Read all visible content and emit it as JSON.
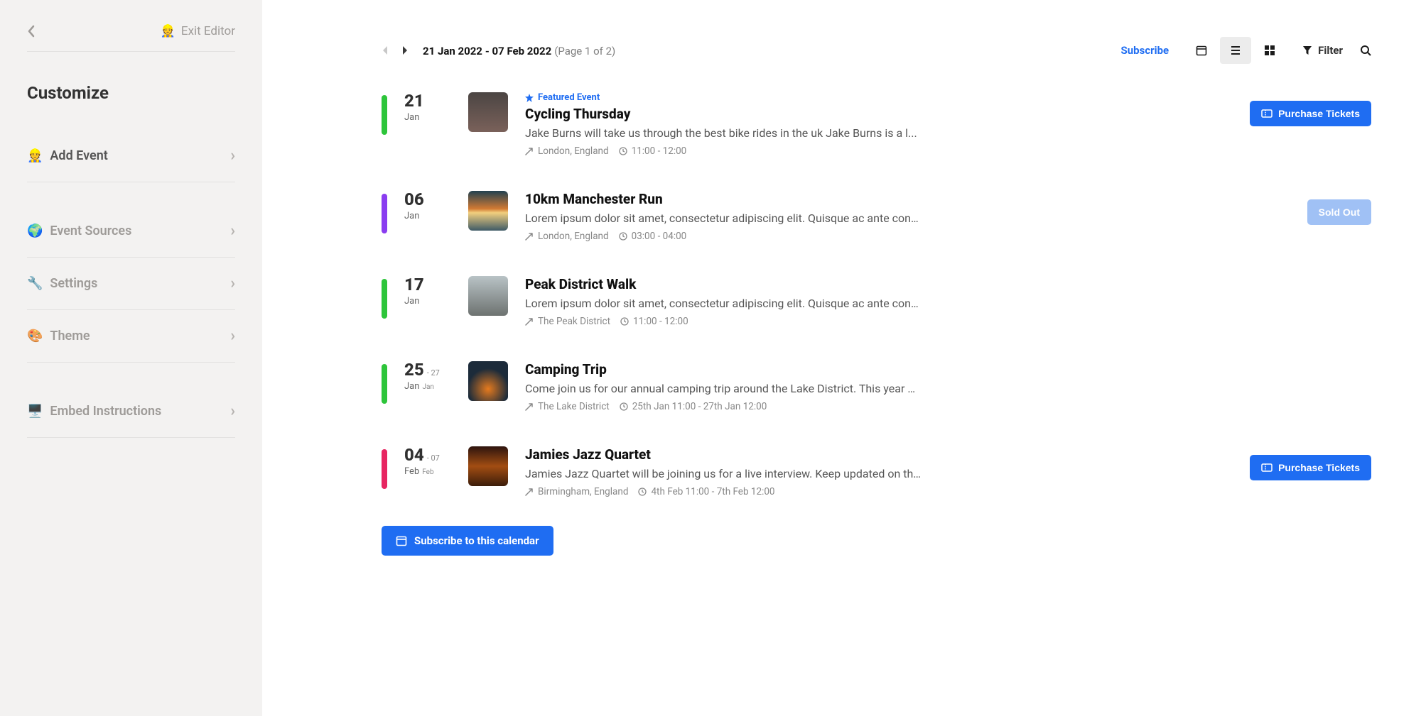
{
  "sidebar": {
    "back_label": "Back",
    "exit_label": "Exit Editor",
    "title": "Customize",
    "items": [
      {
        "emoji": "👷",
        "label": "Add Event"
      },
      {
        "emoji": "🌍",
        "label": "Event Sources"
      },
      {
        "emoji": "🔧",
        "label": "Settings"
      },
      {
        "emoji": "🎨",
        "label": "Theme"
      },
      {
        "emoji": "🖥️",
        "label": "Embed Instructions"
      }
    ]
  },
  "toolbar": {
    "date_start": "21 Jan 2022",
    "date_end": "07 Feb 2022",
    "page_info": "(Page 1 of 2)",
    "subscribe": "Subscribe",
    "filter": "Filter"
  },
  "events": [
    {
      "stripe": "green",
      "day": "21",
      "month": "Jan",
      "featured": "Featured Event",
      "title": "Cycling Thursday",
      "desc": "Jake Burns will take us through the best bike rides in the uk Jake Burns is a l...",
      "location": "London, England",
      "time": "11:00 - 12:00",
      "cta": "Purchase Tickets"
    },
    {
      "stripe": "purple",
      "day": "06",
      "month": "Jan",
      "title": "10km Manchester Run",
      "desc": "Lorem ipsum dolor sit amet, consectetur adipiscing elit. Quisque ac ante consect...",
      "location": "London, England",
      "time": "03:00 - 04:00",
      "cta": "Sold Out"
    },
    {
      "stripe": "green",
      "day": "17",
      "month": "Jan",
      "title": "Peak District Walk",
      "desc": "Lorem ipsum dolor sit amet, consectetur adipiscing elit. Quisque ac ante consect...",
      "location": "The Peak District",
      "time": "11:00 - 12:00"
    },
    {
      "stripe": "green",
      "day": "25",
      "month": "Jan",
      "day_end": "27",
      "month_end": "Jan",
      "title": "Camping Trip",
      "desc": "Come join us for our annual camping trip around the Lake District. This year we...",
      "location": "The Lake District",
      "time": "25th Jan 11:00 - 27th Jan 12:00"
    },
    {
      "stripe": "pink",
      "day": "04",
      "month": "Feb",
      "day_end": "07",
      "month_end": "Feb",
      "title": "Jamies Jazz Quartet",
      "desc": "Jamies Jazz Quartet will be joining us for a live interview. Keep updated on the...",
      "location": "Birmingham, England",
      "time": "4th Feb 11:00 - 7th Feb 12:00",
      "cta": "Purchase Tickets"
    }
  ],
  "footer": {
    "subscribe": "Subscribe to this calendar"
  }
}
